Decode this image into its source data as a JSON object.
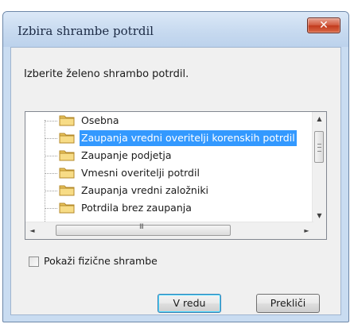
{
  "window": {
    "title": "Izbira shrambe potrdil",
    "close_symbol": "✕"
  },
  "dialog": {
    "prompt": "Izberite želeno shrambo potrdil."
  },
  "tree": {
    "items": [
      {
        "label": "Osebna",
        "selected": false,
        "icon": "folder-icon"
      },
      {
        "label": "Zaupanja vredni overitelji korenskih potrdil",
        "selected": true,
        "icon": "folder-icon"
      },
      {
        "label": "Zaupanje podjetja",
        "selected": false,
        "icon": "folder-icon"
      },
      {
        "label": "Vmesni overitelji potrdil",
        "selected": false,
        "icon": "folder-icon"
      },
      {
        "label": "Zaupanja vredni založniki",
        "selected": false,
        "icon": "folder-icon"
      },
      {
        "label": "Potrdila brez zaupanja",
        "selected": false,
        "icon": "folder-icon"
      }
    ],
    "scroll_up_symbol": "▲",
    "scroll_down_symbol": "▼",
    "scroll_left_symbol": "◄",
    "scroll_right_symbol": "►",
    "h_grip": "III"
  },
  "options": {
    "show_physical_label": "Pokaži fizične shrambe",
    "show_physical_checked": false
  },
  "buttons": {
    "ok_label": "V redu",
    "cancel_label": "Prekliči"
  },
  "colors": {
    "selection": "#3399ff",
    "close_button": "#c23a1d",
    "folder": "#f5d574"
  }
}
